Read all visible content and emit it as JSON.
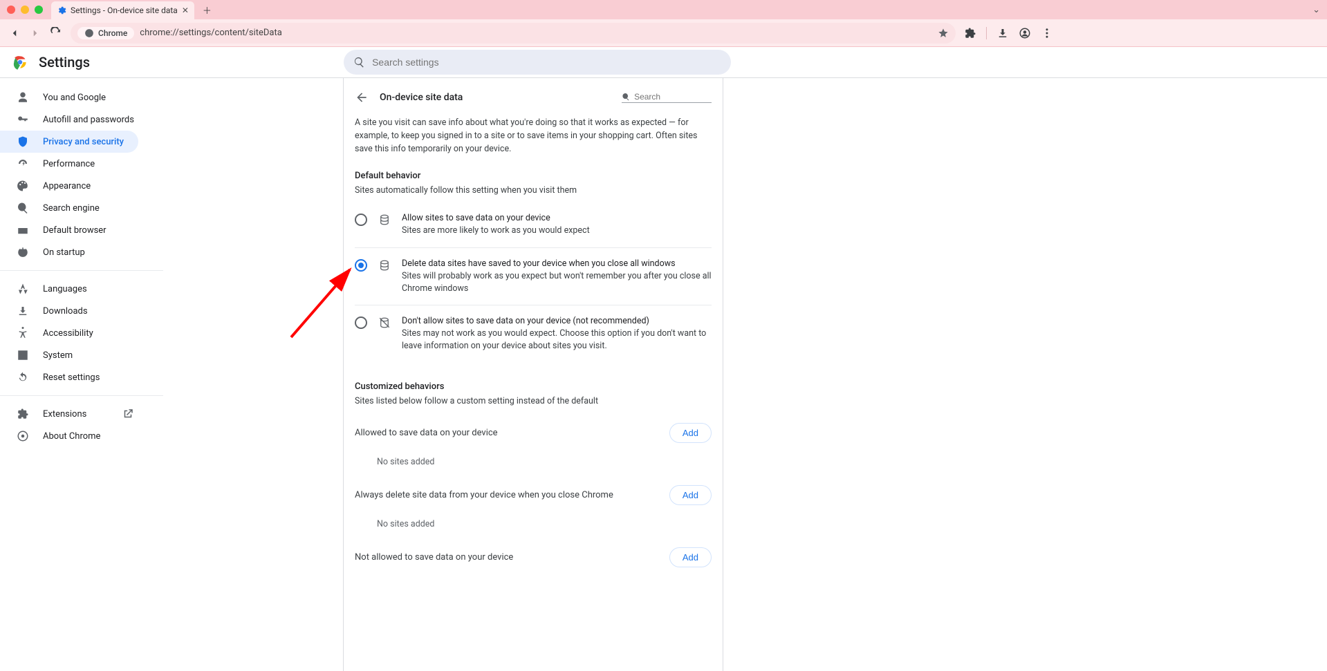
{
  "browser": {
    "tab_title": "Settings - On-device site data",
    "url": "chrome://settings/content/siteData",
    "omni_chip": "Chrome"
  },
  "settings": {
    "app_title": "Settings",
    "search_placeholder": "Search settings"
  },
  "sidebar": {
    "you_google": "You and Google",
    "autofill": "Autofill and passwords",
    "privacy": "Privacy and security",
    "performance": "Performance",
    "appearance": "Appearance",
    "search_engine": "Search engine",
    "default_browser": "Default browser",
    "on_startup": "On startup",
    "languages": "Languages",
    "downloads": "Downloads",
    "accessibility": "Accessibility",
    "system": "System",
    "reset": "Reset settings",
    "extensions": "Extensions",
    "about": "About Chrome"
  },
  "page": {
    "title": "On-device site data",
    "search_placeholder": "Search",
    "intro": "A site you visit can save info about what you're doing so that it works as expected — for example, to keep you signed in to a site or to save items in your shopping cart. Often sites save this info temporarily on your device.",
    "default_behavior_title": "Default behavior",
    "default_behavior_sub": "Sites automatically follow this setting when you visit them",
    "option1": {
      "primary": "Allow sites to save data on your device",
      "secondary": "Sites are more likely to work as you would expect"
    },
    "option2": {
      "primary": "Delete data sites have saved to your device when you close all windows",
      "secondary": "Sites will probably work as you expect but won't remember you after you close all Chrome windows"
    },
    "option3": {
      "primary": "Don't allow sites to save data on your device (not recommended)",
      "secondary": "Sites may not work as you would expect. Choose this option if you don't want to leave information on your device about sites you visit."
    },
    "custom_title": "Customized behaviors",
    "custom_sub": "Sites listed below follow a custom setting instead of the default",
    "allowed_label": "Allowed to save data on your device",
    "always_delete_label": "Always delete site data from your device when you close Chrome",
    "not_allowed_label": "Not allowed to save data on your device",
    "no_sites": "No sites added",
    "add": "Add"
  }
}
